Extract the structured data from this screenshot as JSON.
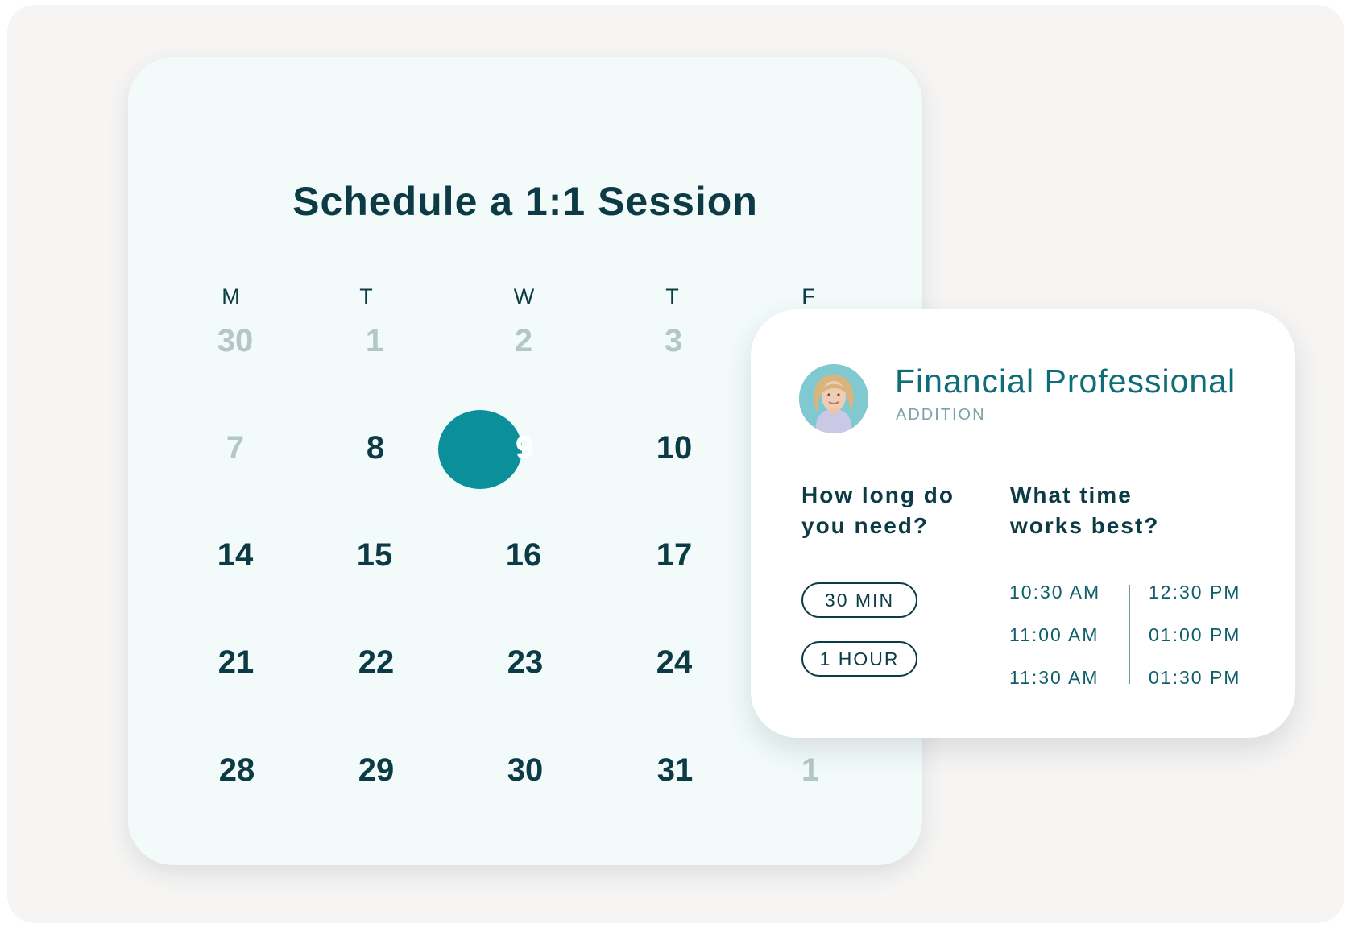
{
  "calendar": {
    "title": "Schedule a 1:1 Session",
    "weekdays": [
      "M",
      "T",
      "W",
      "T",
      "F"
    ],
    "weeks": [
      [
        "30",
        "1",
        "2",
        "3",
        ""
      ],
      [
        "7",
        "8",
        "9",
        "10",
        ""
      ],
      [
        "14",
        "15",
        "16",
        "17",
        ""
      ],
      [
        "21",
        "22",
        "23",
        "24",
        ""
      ],
      [
        "28",
        "29",
        "30",
        "31",
        "1"
      ]
    ],
    "selected_day": "9"
  },
  "advisor": {
    "name": "Financial Professional",
    "subtitle": "ADDITION",
    "avatar_icon": "person-photo-icon"
  },
  "duration": {
    "question": "How long do you need?",
    "options": [
      "30 MIN",
      "1 HOUR"
    ]
  },
  "time": {
    "question": "What time works best?",
    "left_column": [
      "10:30 AM",
      "11:00 AM",
      "11:30 AM"
    ],
    "right_column": [
      "12:30 PM",
      "01:00 PM",
      "01:30 PM"
    ]
  },
  "colors": {
    "accent": "#0b8f9b",
    "dark_text": "#0c3b45",
    "muted_day": "#b3c7c9"
  }
}
